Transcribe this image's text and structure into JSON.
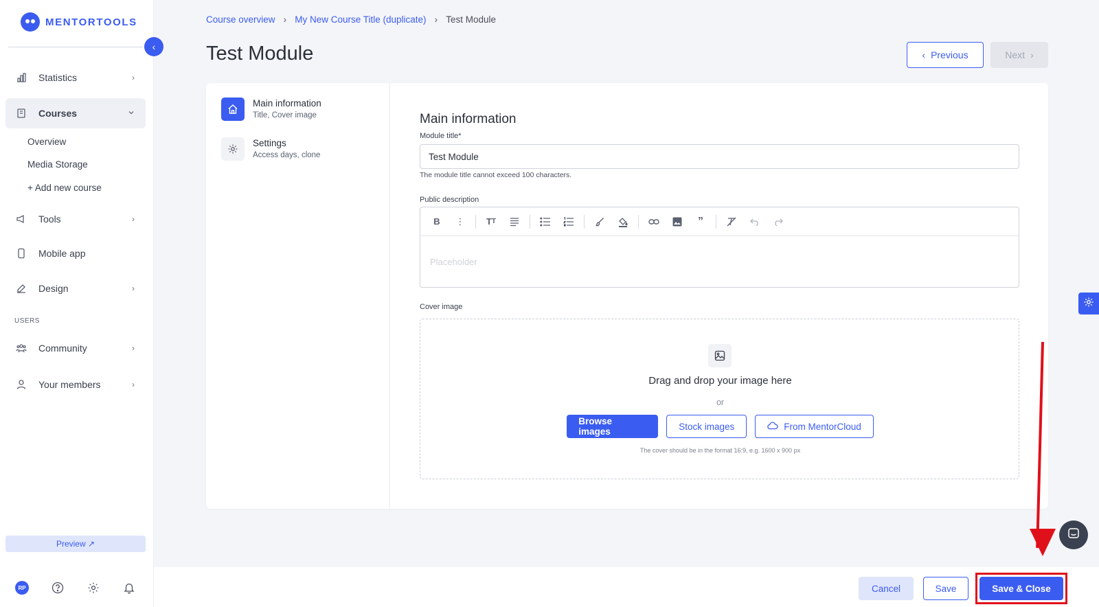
{
  "brand": {
    "name": "MENTORTOOLS",
    "color": "#3b5cf0"
  },
  "sidebar": {
    "items": [
      {
        "label": "Statistics",
        "icon": "bar-chart-icon"
      },
      {
        "label": "Courses",
        "icon": "book-icon"
      },
      {
        "label": "Tools",
        "icon": "megaphone-icon"
      },
      {
        "label": "Mobile app",
        "icon": "phone-icon"
      },
      {
        "label": "Design",
        "icon": "pencil-icon"
      },
      {
        "label": "Community",
        "icon": "people-icon"
      },
      {
        "label": "Your members",
        "icon": "person-icon"
      }
    ],
    "courses_sub": [
      "Overview",
      "Media Storage",
      "+ Add new course"
    ],
    "users_heading": "USERS",
    "preview_label": "Preview ↗",
    "avatar_initials": "RP"
  },
  "breadcrumb": {
    "items": [
      "Course overview",
      "My New Course Title (duplicate)",
      "Test Module"
    ]
  },
  "page": {
    "title": "Test Module",
    "prev_label": "Previous",
    "next_label": "Next"
  },
  "steps": [
    {
      "title": "Main information",
      "sub": "Title, Cover image"
    },
    {
      "title": "Settings",
      "sub": "Access days, clone"
    }
  ],
  "form": {
    "section_title": "Main information",
    "module_title_label": "Module title*",
    "module_title_value": "Test Module",
    "module_title_hint": "The module title cannot exceed 100 characters.",
    "description_label": "Public description",
    "description_placeholder": "Placeholder",
    "cover_label": "Cover image",
    "dropzone_main": "Drag and drop your image here",
    "dropzone_or": "or",
    "browse_label": "Browse images",
    "stock_label": "Stock images",
    "cloud_label": "From MentorCloud",
    "cover_note": "The cover should be in the format 16:9, e.g. 1600 x 900 px"
  },
  "footer": {
    "cancel_label": "Cancel",
    "save_label": "Save",
    "save_close_label": "Save & Close"
  },
  "annotation_color": "#e0101a"
}
